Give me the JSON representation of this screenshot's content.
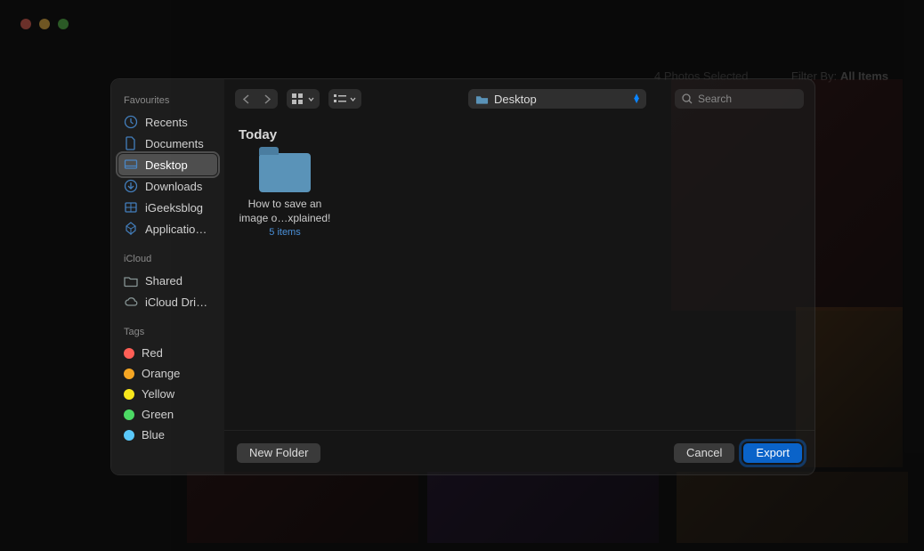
{
  "bg": {
    "filter_label": "Filter By:",
    "filter_value": "All Items",
    "selection": "4 Photos Selected"
  },
  "sheet": {
    "sidebar": {
      "sec_fav": "Favourites",
      "favourites": [
        {
          "label": "Recents",
          "icon": "clock"
        },
        {
          "label": "Documents",
          "icon": "doc"
        },
        {
          "label": "Desktop",
          "icon": "desktop",
          "selected": true
        },
        {
          "label": "Downloads",
          "icon": "download"
        },
        {
          "label": "iGeeksblog",
          "icon": "folder"
        },
        {
          "label": "Applicatio…",
          "icon": "app"
        }
      ],
      "sec_icloud": "iCloud",
      "icloud": [
        {
          "label": "Shared",
          "icon": "shared"
        },
        {
          "label": "iCloud Dri…",
          "icon": "cloud"
        }
      ],
      "sec_tags": "Tags",
      "tags": [
        {
          "label": "Red",
          "class": "tag-red"
        },
        {
          "label": "Orange",
          "class": "tag-orange"
        },
        {
          "label": "Yellow",
          "class": "tag-yellow"
        },
        {
          "label": "Green",
          "class": "tag-green"
        },
        {
          "label": "Blue",
          "class": "tag-blue"
        }
      ]
    },
    "toolbar": {
      "path": "Desktop",
      "search_placeholder": "Search"
    },
    "content": {
      "group": "Today",
      "file": {
        "name": "How to save an image o…xplained!",
        "meta": "5 items"
      }
    },
    "footer": {
      "new_folder": "New Folder",
      "cancel": "Cancel",
      "export": "Export"
    }
  }
}
